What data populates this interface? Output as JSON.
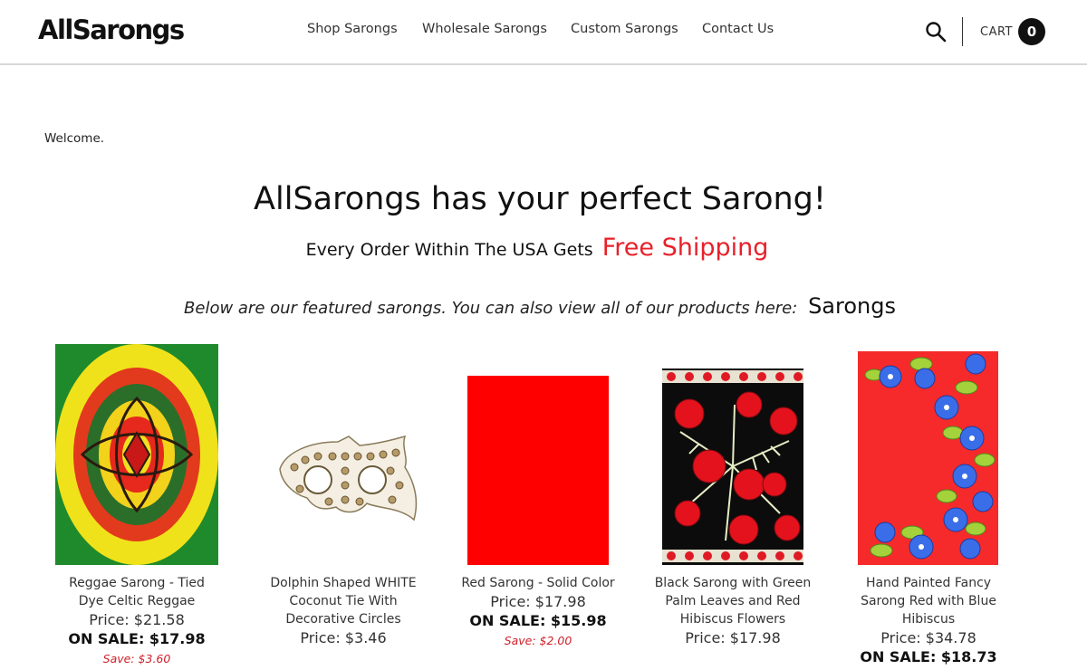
{
  "header": {
    "logo": "AllSarongs",
    "nav": [
      {
        "label": "Shop Sarongs"
      },
      {
        "label": "Wholesale Sarongs"
      },
      {
        "label": "Custom Sarongs"
      },
      {
        "label": "Contact Us"
      }
    ],
    "cart_label": "CART",
    "cart_count": "0"
  },
  "main": {
    "welcome": "Welcome.",
    "headline": "AllSarongs has your perfect Sarong!",
    "shipping_text": "Every Order Within The USA Gets",
    "shipping_highlight": "Free Shipping",
    "featured_text": "Below are our featured sarongs. You can also view all of our products here:",
    "featured_link": "Sarongs"
  },
  "products": [
    {
      "name": "Reggae Sarong - Tied Dye Celtic Reggae",
      "price": "Price: $21.58",
      "sale": "ON SALE: $17.98",
      "save": "Save: $3.60"
    },
    {
      "name": "Dolphin Shaped WHITE Coconut Tie With Decorative Circles",
      "price": "Price: $3.46"
    },
    {
      "name": "Red Sarong - Solid Color",
      "price": "Price: $17.98",
      "sale": "ON SALE: $15.98",
      "save": "Save: $2.00"
    },
    {
      "name": "Black Sarong with Green Palm Leaves and Red Hibiscus Flowers",
      "price": "Price: $17.98"
    },
    {
      "name": "Hand Painted Fancy Sarong Red with Blue Hibiscus",
      "price": "Price: $34.78",
      "sale": "ON SALE: $18.73"
    }
  ],
  "colors": {
    "accent_red": "#e8202a",
    "save_red": "#d0202a",
    "cart_badge": "#111111"
  },
  "icons": {
    "search": "search-icon"
  }
}
